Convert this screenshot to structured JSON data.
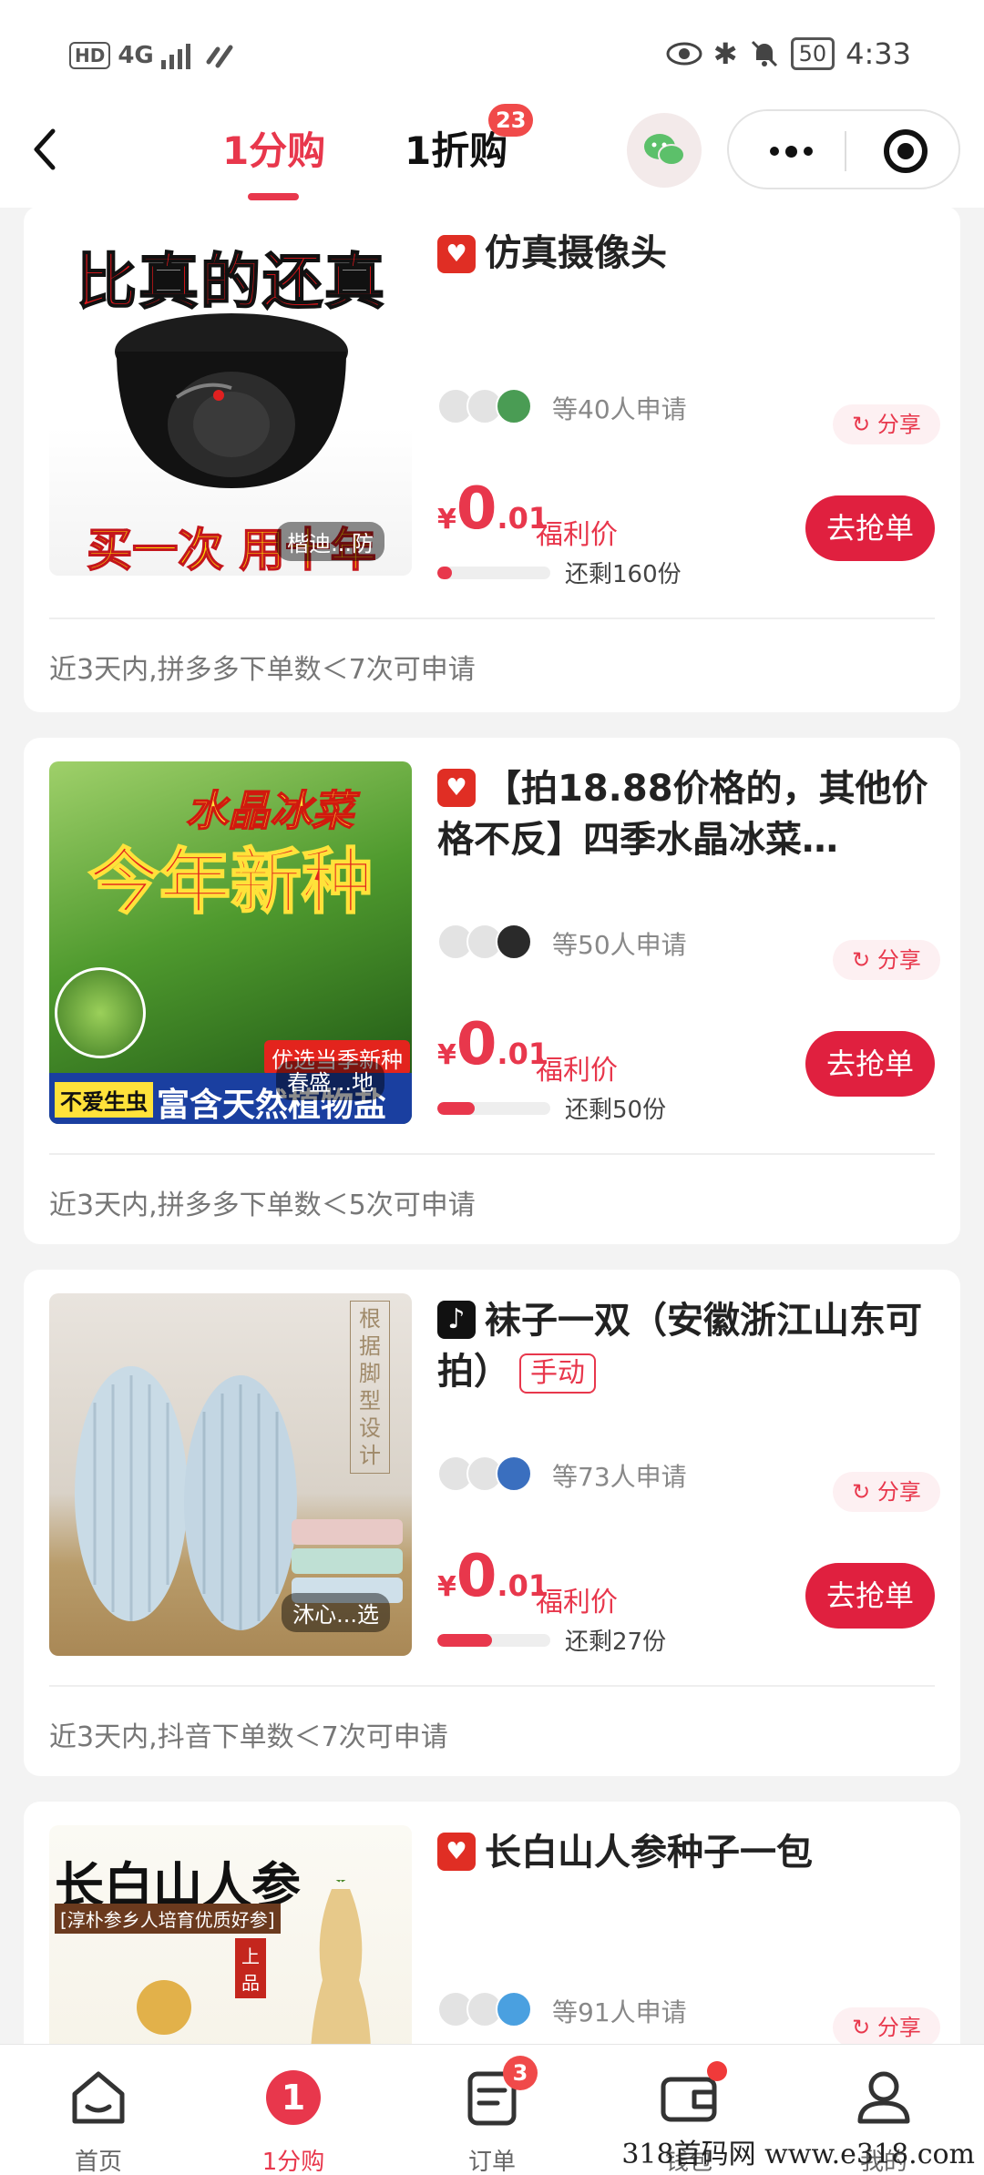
{
  "status_bar": {
    "hd": "HD",
    "network": "4G",
    "battery": "50",
    "time": "4:33"
  },
  "nav": {
    "tabs": [
      {
        "label": "1分购"
      },
      {
        "label": "1折购"
      }
    ],
    "tab2_badge": "23",
    "icons": [
      "back-icon",
      "wechat-icon",
      "more-icon",
      "target-icon"
    ]
  },
  "items": [
    {
      "platform": "pinduoduo",
      "title": "仿真摄像头",
      "image_text": {
        "top": "比真的还真",
        "bottom": "买一次 用十年",
        "tag": "楷迪...防"
      },
      "applicants": "等40人申请",
      "share_label": "分享",
      "price_symbol": "¥",
      "price_int": "0",
      "price_dec": ".01",
      "price_label": "福利价",
      "progress": 0.13,
      "remaining": "还剩160份",
      "button": "去抢单",
      "rule": "近3天内,拼多多下单数＜7次可申请"
    },
    {
      "platform": "pinduoduo",
      "title": "【拍18.88价格的，其他价格不反】四季水晶冰菜…",
      "image_text": {
        "top": "水晶冰菜",
        "middle": "今年新种",
        "ribbon": "优选当季新种",
        "left_tag": "不爱生虫",
        "bottom": "富含天然植物盐",
        "tag": "春盛...地"
      },
      "applicants": "等50人申请",
      "share_label": "分享",
      "price_symbol": "¥",
      "price_int": "0",
      "price_dec": ".01",
      "price_label": "福利价",
      "progress": 0.33,
      "remaining": "还剩50份",
      "button": "去抢单",
      "rule": "近3天内,拼多多下单数＜5次可申请"
    },
    {
      "platform": "douyin",
      "title": "袜子一双（安徽浙江山东可拍）",
      "manual_tag": "手动",
      "image_text": {
        "side": "根据脚型设计",
        "tag": "沐心...选"
      },
      "applicants": "等73人申请",
      "share_label": "分享",
      "price_symbol": "¥",
      "price_int": "0",
      "price_dec": ".01",
      "price_label": "福利价",
      "progress": 0.48,
      "remaining": "还剩27份",
      "button": "去抢单",
      "rule": "近3天内,抖音下单数＜7次可申请"
    },
    {
      "platform": "pinduoduo",
      "title": "长白山人参种子一包",
      "image_text": {
        "top": "长白山人参",
        "sub": "[淳朴参乡人培育优质好参]",
        "badge": "上品"
      },
      "applicants": "等91人申请",
      "share_label": "分享"
    }
  ],
  "tabbar": [
    {
      "label": "首页",
      "icon": "home-icon"
    },
    {
      "label": "1分购",
      "icon": "one-cent-icon",
      "active": true
    },
    {
      "label": "订单",
      "icon": "order-icon",
      "badge": "3"
    },
    {
      "label": "钱包",
      "icon": "wallet-icon",
      "dot": true
    },
    {
      "label": "我的",
      "icon": "profile-icon"
    }
  ],
  "watermark": "318首码网 www.e318.com",
  "colors": {
    "accent": "#e8374c",
    "button": "#e0203f",
    "pinduoduo": "#e02e24"
  }
}
